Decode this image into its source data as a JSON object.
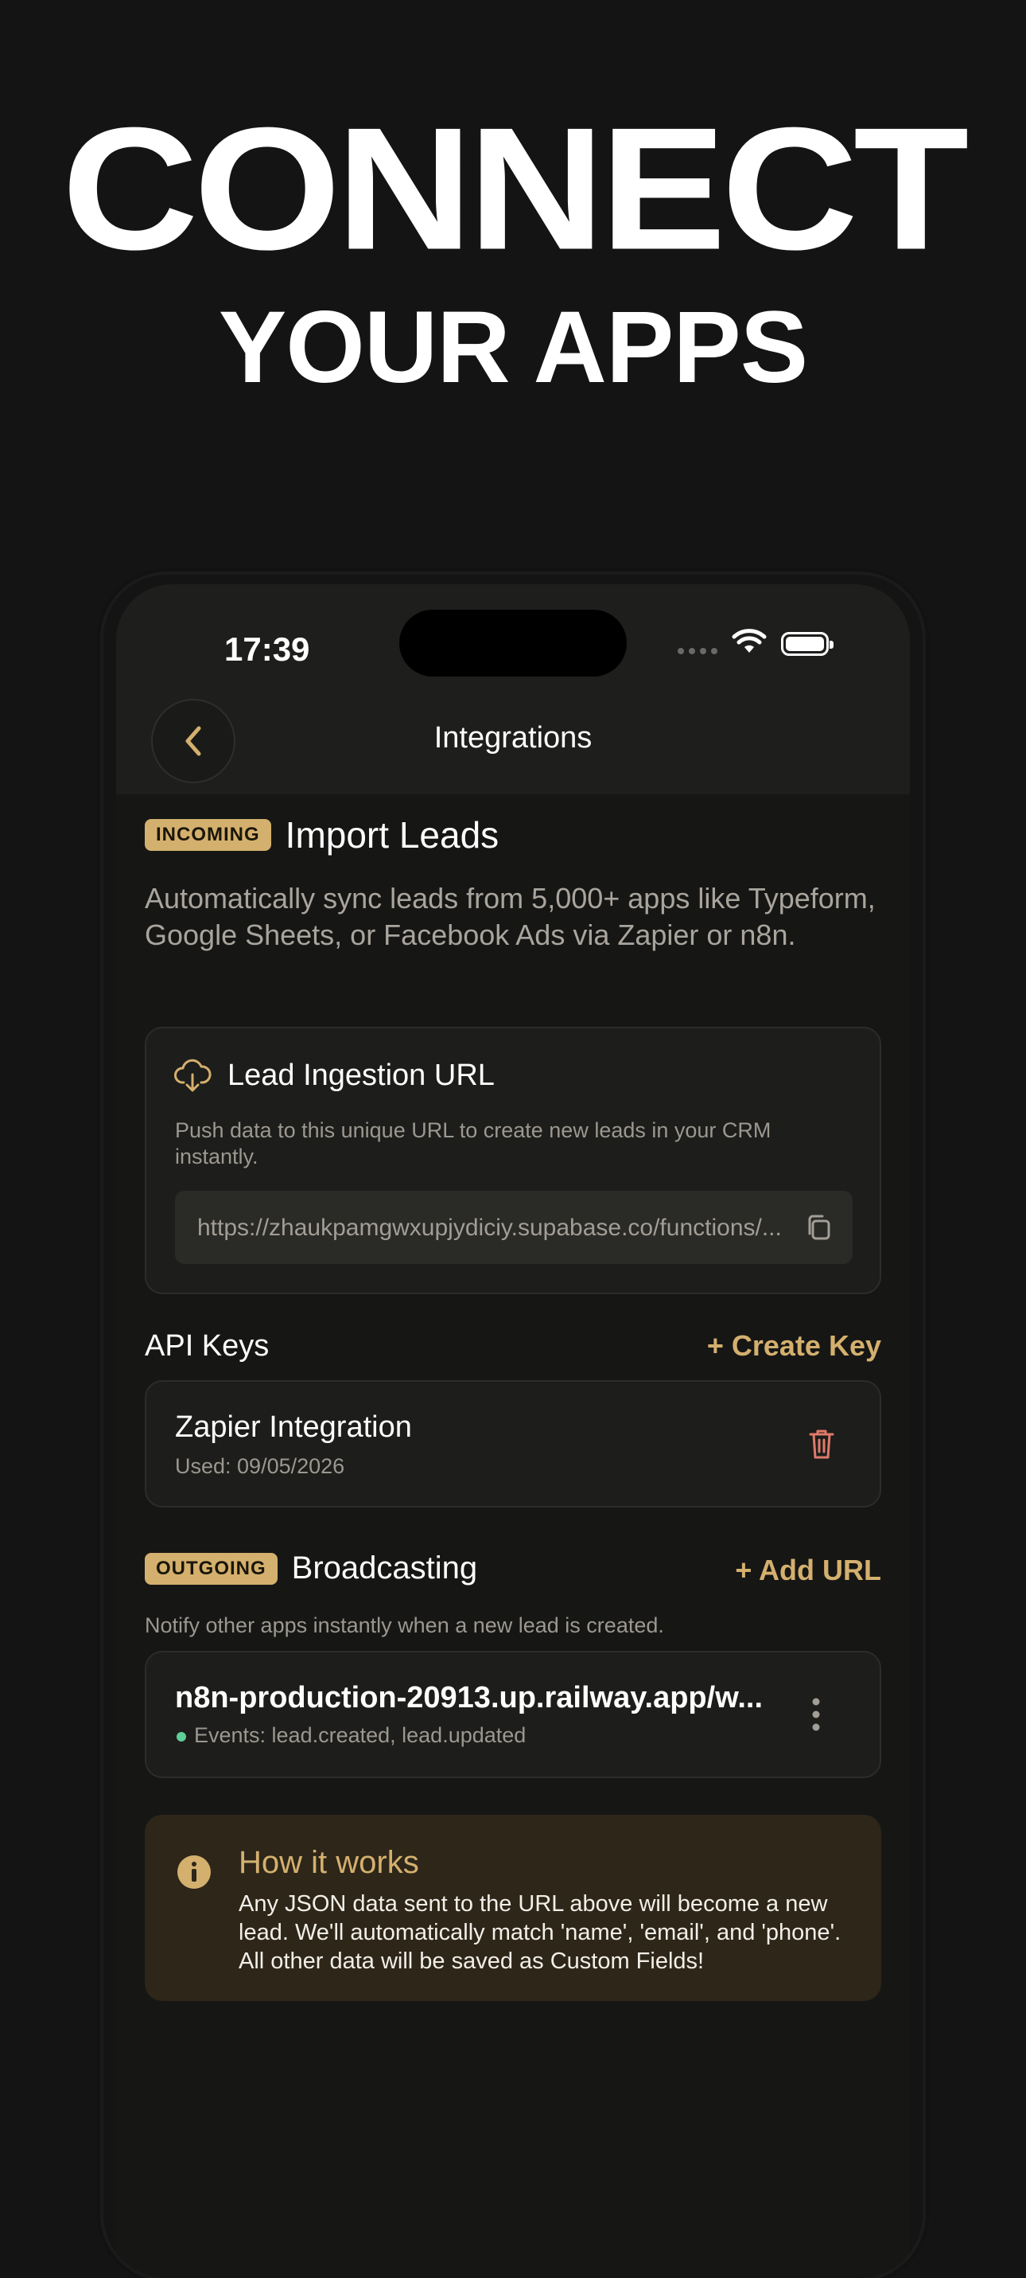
{
  "hero": {
    "line1": "CONNECT",
    "line2": "YOUR APPS"
  },
  "status_bar": {
    "time": "17:39"
  },
  "nav": {
    "title": "Integrations"
  },
  "incoming": {
    "badge": "INCOMING",
    "title": "Import Leads",
    "description": "Automatically sync leads from 5,000+ apps like Typeform, Google Sheets, or Facebook Ads via Zapier or n8n."
  },
  "ingestion": {
    "title": "Lead Ingestion URL",
    "description": "Push data to this unique URL to create new leads in your CRM instantly.",
    "url": "https://zhaukpamgwxupjydiciy.supabase.co/functions/..."
  },
  "api_keys": {
    "title": "API Keys",
    "create_label": "+ Create Key",
    "items": [
      {
        "name": "Zapier Integration",
        "used": "Used: 09/05/2026"
      }
    ]
  },
  "outgoing": {
    "badge": "OUTGOING",
    "title": "Broadcasting",
    "add_label": "+ Add URL",
    "description": "Notify other apps instantly when a new lead is created.",
    "webhooks": [
      {
        "url": "n8n-production-20913.up.railway.app/w...",
        "events": "Events: lead.created, lead.updated"
      }
    ]
  },
  "how_it_works": {
    "title": "How it works",
    "body": "Any JSON data sent to the URL above will become a new lead. We'll automatically match 'name', 'email', and 'phone'. All other data will be saved as Custom Fields!"
  },
  "colors": {
    "accent": "#d4b06e",
    "danger": "#e07a6a",
    "active_dot": "#5fcf9a",
    "background": "#141414"
  },
  "icons": [
    "back-chevron-icon",
    "wifi-icon",
    "battery-icon",
    "cloud-download-icon",
    "copy-icon",
    "trash-icon",
    "more-vertical-icon",
    "info-icon"
  ]
}
